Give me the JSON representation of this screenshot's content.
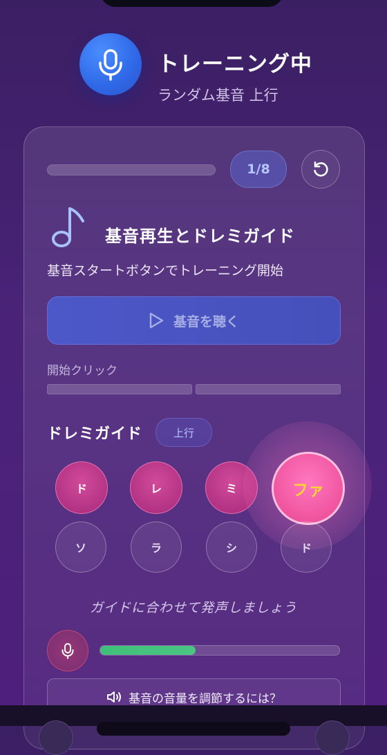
{
  "header": {
    "title": "トレーニング中",
    "subtitle": "ランダム基音 上行",
    "mic_icon": "microphone-icon",
    "accent_color": "#3a74f0"
  },
  "progress": {
    "count": "1/8",
    "fraction": 0,
    "reset_icon": "reset-icon"
  },
  "section": {
    "icon": "music-note-icon",
    "title": "基音再生とドレミガイド",
    "instruction": "基音スタートボタンでトレーニング開始"
  },
  "play_button": {
    "label": "基音を聴く",
    "icon": "play-icon"
  },
  "start": {
    "label": "開始クリック"
  },
  "doremi": {
    "title": "ドレミガイド",
    "direction": "上行",
    "notes_row1": [
      "ド",
      "レ",
      "ミ",
      "ファ"
    ],
    "notes_row2": [
      "ソ",
      "ラ",
      "シ",
      "ド"
    ],
    "active_note_index": 3,
    "active_color": "#ff6cb6",
    "active_text_color": "#ffd23a"
  },
  "guide_text": "ガイドに合わせて発声しましょう",
  "input_level": {
    "mic_icon": "microphone-icon",
    "level": 0.4,
    "color": "#44c27f"
  },
  "volume_help": {
    "icon": "speaker-icon",
    "label": "基音の音量を調節するには？"
  }
}
